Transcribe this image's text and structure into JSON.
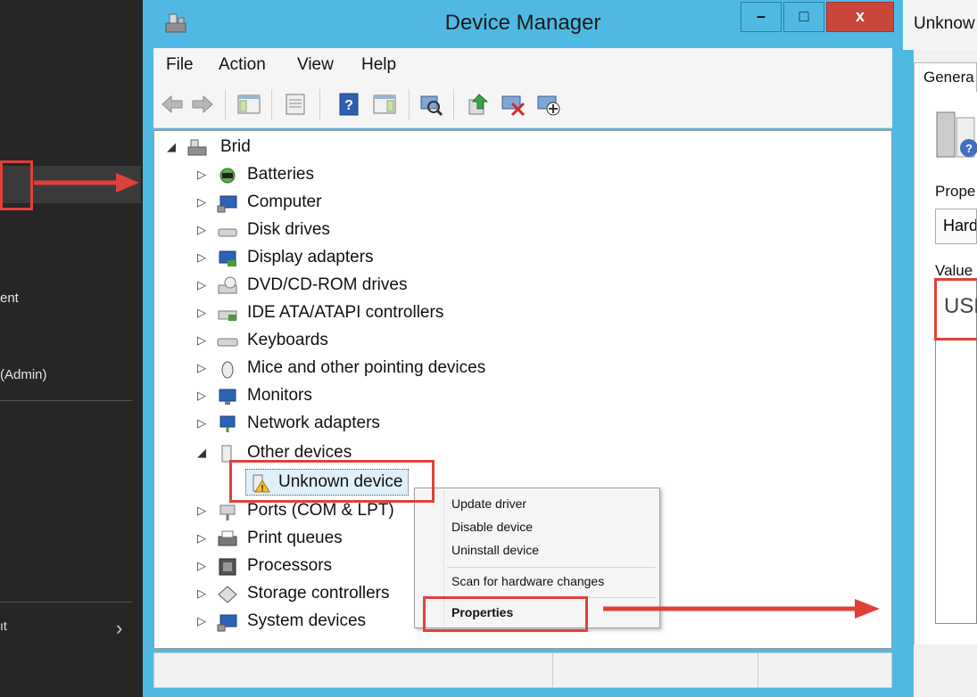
{
  "left_menu": {
    "items": [
      {
        "label": "ent"
      },
      {
        "label": "(Admin)"
      }
    ]
  },
  "window": {
    "title": "Device Manager",
    "minimize_label": "–",
    "maximize_label": "□",
    "close_label": "x"
  },
  "menubar": {
    "file": "File",
    "action": "Action",
    "view": "View",
    "help": "Help"
  },
  "toolbar": {
    "icons": [
      "back-icon",
      "forward-icon",
      "show-hide-console-tree-icon",
      "properties-icon",
      "help-icon",
      "action-pane-icon",
      "scan-hardware-icon",
      "update-driver-icon",
      "uninstall-device-icon",
      "add-legacy-hardware-icon"
    ]
  },
  "tree": {
    "root": "Brid",
    "categories": [
      {
        "label": "Batteries",
        "icon": "battery-icon"
      },
      {
        "label": "Computer",
        "icon": "computer-icon"
      },
      {
        "label": "Disk drives",
        "icon": "disk-drive-icon"
      },
      {
        "label": "Display adapters",
        "icon": "display-adapter-icon"
      },
      {
        "label": "DVD/CD-ROM drives",
        "icon": "dvd-drive-icon"
      },
      {
        "label": "IDE ATA/ATAPI controllers",
        "icon": "ide-controller-icon"
      },
      {
        "label": "Keyboards",
        "icon": "keyboard-icon"
      },
      {
        "label": "Mice and other pointing devices",
        "icon": "mouse-icon"
      },
      {
        "label": "Monitors",
        "icon": "monitor-icon"
      },
      {
        "label": "Network adapters",
        "icon": "network-adapter-icon"
      },
      {
        "label": "Other devices",
        "icon": "other-devices-icon"
      },
      {
        "label": "Unknown device",
        "icon": "unknown-device-warning-icon"
      },
      {
        "label": "Ports (COM & LPT)",
        "icon": "port-icon"
      },
      {
        "label": "Print queues",
        "icon": "printer-icon"
      },
      {
        "label": "Processors",
        "icon": "processor-icon"
      },
      {
        "label": "Storage controllers",
        "icon": "storage-controller-icon"
      },
      {
        "label": "System devices",
        "icon": "system-devices-icon"
      }
    ]
  },
  "context_menu": {
    "update_driver": "Update driver",
    "disable_device": "Disable device",
    "uninstall_device": "Uninstall device",
    "scan_hardware": "Scan for hardware changes",
    "properties": "Properties"
  },
  "properties_window": {
    "title": "Unknow",
    "tab": "Genera",
    "property_label": "Prope",
    "property_value": "Hard",
    "value_label": "Value",
    "value_text": "USE"
  },
  "colors": {
    "title_bar": "#4fb9e3",
    "close_button": "#c9473a",
    "annotation_red": "#e0403a",
    "dark_menu": "#262626"
  }
}
